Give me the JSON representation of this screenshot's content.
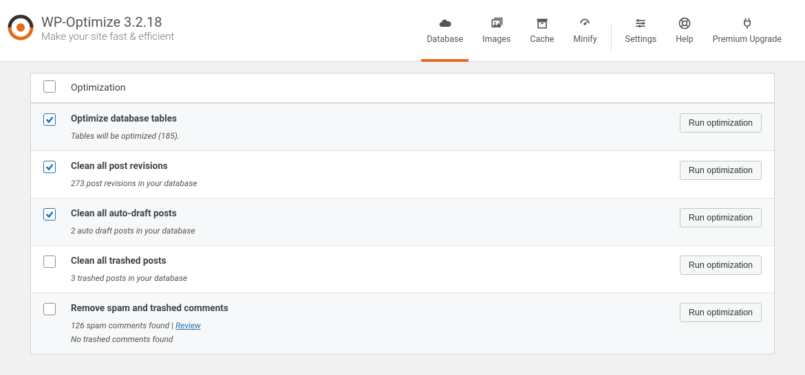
{
  "brand": {
    "title": "WP-Optimize 3.2.18",
    "subtitle": "Make your site fast & efficient"
  },
  "tabs": {
    "database": "Database",
    "images": "Images",
    "cache": "Cache",
    "minify": "Minify",
    "settings": "Settings",
    "help": "Help",
    "premium": "Premium Upgrade"
  },
  "table_header": "Optimization",
  "rows": {
    "optimize_tables": {
      "title": "Optimize database tables",
      "desc": "Tables will be optimized (185).",
      "button": "Run optimization"
    },
    "revisions": {
      "title": "Clean all post revisions",
      "desc": "273 post revisions in your database",
      "button": "Run optimization"
    },
    "autodrafts": {
      "title": "Clean all auto-draft posts",
      "desc": "2 auto draft posts in your database",
      "button": "Run optimization"
    },
    "trashed_posts": {
      "title": "Clean all trashed posts",
      "desc": "3 trashed posts in your database",
      "button": "Run optimization"
    },
    "spam": {
      "title": "Remove spam and trashed comments",
      "desc_part": "126 spam comments found",
      "sep": " | ",
      "review": "Review",
      "desc2": "No trashed comments found",
      "button": "Run optimization"
    }
  }
}
